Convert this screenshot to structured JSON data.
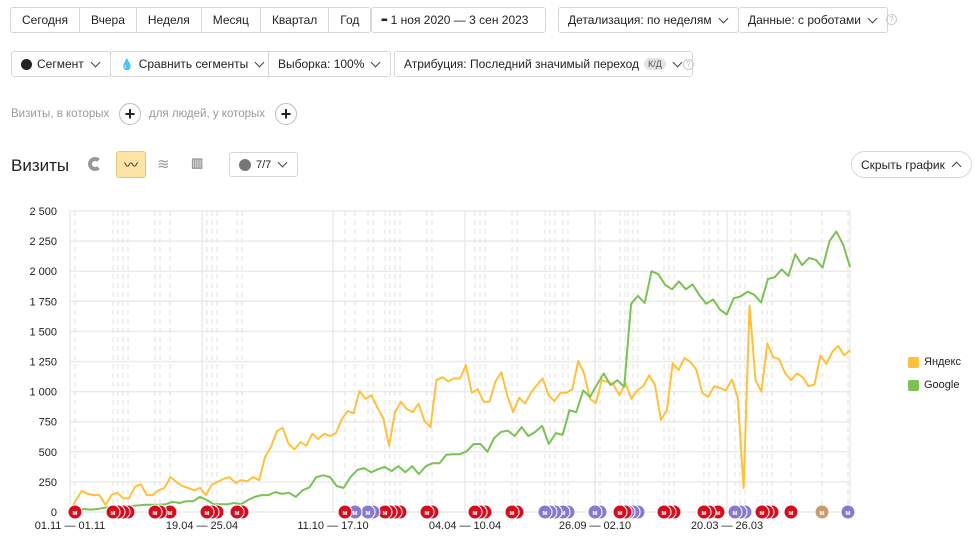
{
  "toolbar": {
    "periods": [
      "Сегодня",
      "Вчера",
      "Неделя",
      "Месяц",
      "Квартал",
      "Год"
    ],
    "date_range": "1 ноя 2020 — 3 сен 2023",
    "detail": "Детализация: по неделям",
    "data_mode": "Данные: с роботами",
    "segment": "Сегмент",
    "compare": "Сравнить сегменты",
    "sample": "Выборка: 100%",
    "attribution": "Атрибуция: Последний значимый переход",
    "attribution_badge": "К/Д",
    "help": "?"
  },
  "filters": {
    "visits_label": "Визиты, в которых",
    "people_label": "для людей, у которых",
    "add": "+"
  },
  "chart_header": {
    "title": "Визиты",
    "notes_count": "7/7",
    "hide_chart": "Скрыть график",
    "active_view": "line"
  },
  "chart_data": {
    "type": "line",
    "title": "",
    "ylim": [
      0,
      2500
    ],
    "yticks": [
      "0",
      "250",
      "500",
      "750",
      "1 000",
      "1 250",
      "1 500",
      "1 750",
      "2 000",
      "2 250",
      "2 500"
    ],
    "ytick_values": [
      0,
      250,
      500,
      750,
      1000,
      1250,
      1500,
      1750,
      2000,
      2250,
      2500
    ],
    "xtick_labels": [
      "01.11 — 01.11",
      "19.04 — 25.04",
      "11.10 — 17.10",
      "04.04 — 10.04",
      "26.09 — 02.10",
      "20.03 — 26.03"
    ],
    "x_period": [
      "2020-11-01",
      "2023-09-03"
    ],
    "grid": true,
    "legend_position": "right",
    "series": [
      {
        "name": "Яндекс",
        "color": "#ffc13b",
        "values": [
          0,
          100,
          175,
          150,
          140,
          140,
          60,
          140,
          160,
          115,
          115,
          210,
          230,
          140,
          140,
          180,
          200,
          290,
          250,
          215,
          200,
          180,
          200,
          140,
          225,
          250,
          275,
          290,
          240,
          265,
          255,
          290,
          265,
          455,
          540,
          670,
          700,
          565,
          520,
          580,
          550,
          650,
          605,
          650,
          630,
          655,
          770,
          840,
          820,
          1005,
          940,
          970,
          870,
          780,
          550,
          830,
          915,
          855,
          830,
          900,
          755,
          705,
          1095,
          1120,
          1085,
          1110,
          1110,
          1220,
          990,
          1020,
          915,
          915,
          1085,
          1160,
          965,
          830,
          950,
          900,
          990,
          1055,
          1110,
          970,
          920,
          990,
          990,
          1020,
          1255,
          1150,
          940,
          905,
          1095,
          1080,
          1055,
          970,
          1070,
          940,
          1010,
          1045,
          1135,
          1055,
          765,
          845,
          1235,
          1180,
          1280,
          1245,
          1180,
          990,
          955,
          1045,
          1030,
          1010,
          1100,
          955,
          200,
          1715,
          1095,
          1000,
          1400,
          1285,
          1270,
          1155,
          1095,
          1150,
          1120,
          1045,
          1060,
          1300,
          1230,
          1330,
          1380,
          1300,
          1345
        ]
      },
      {
        "name": "Google",
        "color": "#7cc156",
        "values": [
          0,
          15,
          25,
          20,
          25,
          35,
          40,
          50,
          50,
          50,
          55,
          60,
          60,
          60,
          65,
          85,
          75,
          90,
          90,
          125,
          100,
          65,
          65,
          65,
          75,
          65,
          100,
          125,
          140,
          140,
          165,
          150,
          160,
          125,
          180,
          205,
          290,
          305,
          290,
          215,
          200,
          290,
          350,
          365,
          330,
          355,
          375,
          340,
          380,
          330,
          380,
          315,
          380,
          405,
          405,
          475,
          480,
          480,
          505,
          565,
          565,
          500,
          615,
          665,
          675,
          630,
          705,
          630,
          665,
          715,
          565,
          655,
          640,
          845,
          830,
          1010,
          955,
          1055,
          1150,
          1055,
          1095,
          1040,
          1730,
          1795,
          1735,
          2000,
          1975,
          1885,
          1850,
          1915,
          1850,
          1890,
          1800,
          1730,
          1765,
          1680,
          1640,
          1775,
          1790,
          1830,
          1805,
          1740,
          1935,
          1950,
          2015,
          1960,
          2140,
          2050,
          2110,
          2095,
          2030,
          2250,
          2330,
          2220,
          2035
        ]
      }
    ],
    "annotation_colors": {
      "holiday": "#d40d1f",
      "note": "#8a78d0",
      "other": "#c99b6b"
    },
    "annotation_label": "м"
  }
}
